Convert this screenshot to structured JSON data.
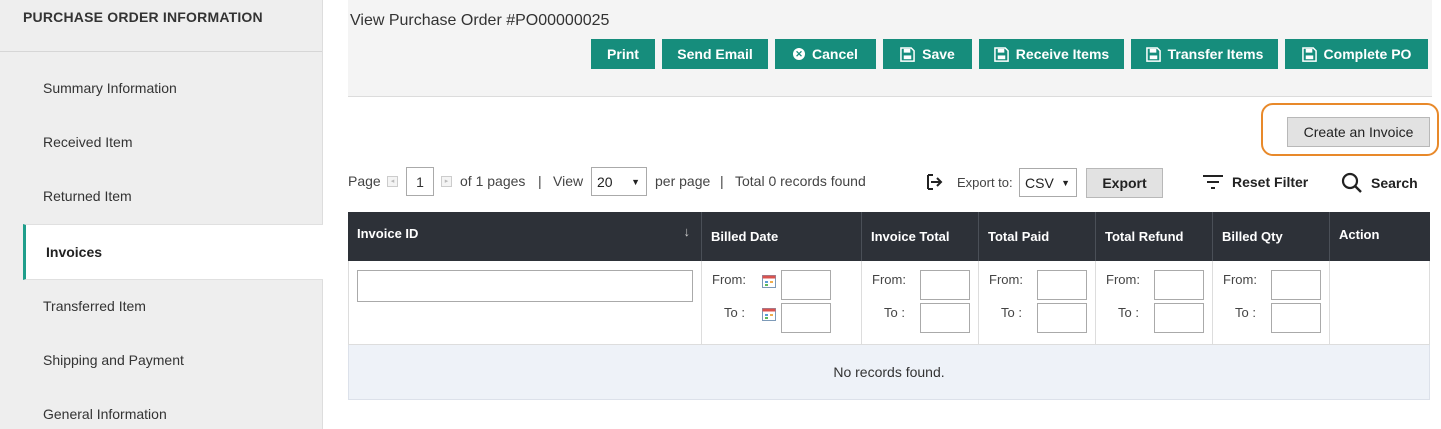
{
  "sidebar": {
    "header": "PURCHASE ORDER INFORMATION",
    "items": [
      {
        "label": "Summary Information"
      },
      {
        "label": "Received Item"
      },
      {
        "label": "Returned Item"
      },
      {
        "label": "Invoices",
        "active": true
      },
      {
        "label": "Transferred Item"
      },
      {
        "label": "Shipping and Payment"
      },
      {
        "label": "General Information"
      }
    ]
  },
  "header": {
    "title": "View Purchase Order #PO00000025",
    "buttons": {
      "print": "Print",
      "send_email": "Send Email",
      "cancel": "Cancel",
      "save": "Save",
      "receive_items": "Receive Items",
      "transfer_items": "Transfer Items",
      "complete_po": "Complete PO"
    }
  },
  "create_invoice_label": "Create an Invoice",
  "paging": {
    "page_label": "Page",
    "current_page": "1",
    "of_pages": "of 1 pages",
    "sep1": "|",
    "view_label": "View",
    "per_page_value": "20",
    "per_page_label": "per page",
    "sep2": "|",
    "total_text": "Total 0 records found",
    "export_to_label": "Export to:",
    "export_format": "CSV",
    "export_button": "Export",
    "reset_filter": "Reset Filter",
    "search": "Search"
  },
  "table": {
    "columns": {
      "invoice_id": "Invoice ID",
      "billed_date": "Billed Date",
      "invoice_total": "Invoice Total",
      "total_paid": "Total Paid",
      "total_refund": "Total Refund",
      "billed_qty": "Billed Qty",
      "action": "Action"
    },
    "filter": {
      "from": "From:",
      "to": "To :"
    },
    "empty_message": "No records found."
  },
  "colors": {
    "accent": "#168d7c",
    "header_dark": "#2d3138",
    "highlight_ring": "#e8892a"
  }
}
